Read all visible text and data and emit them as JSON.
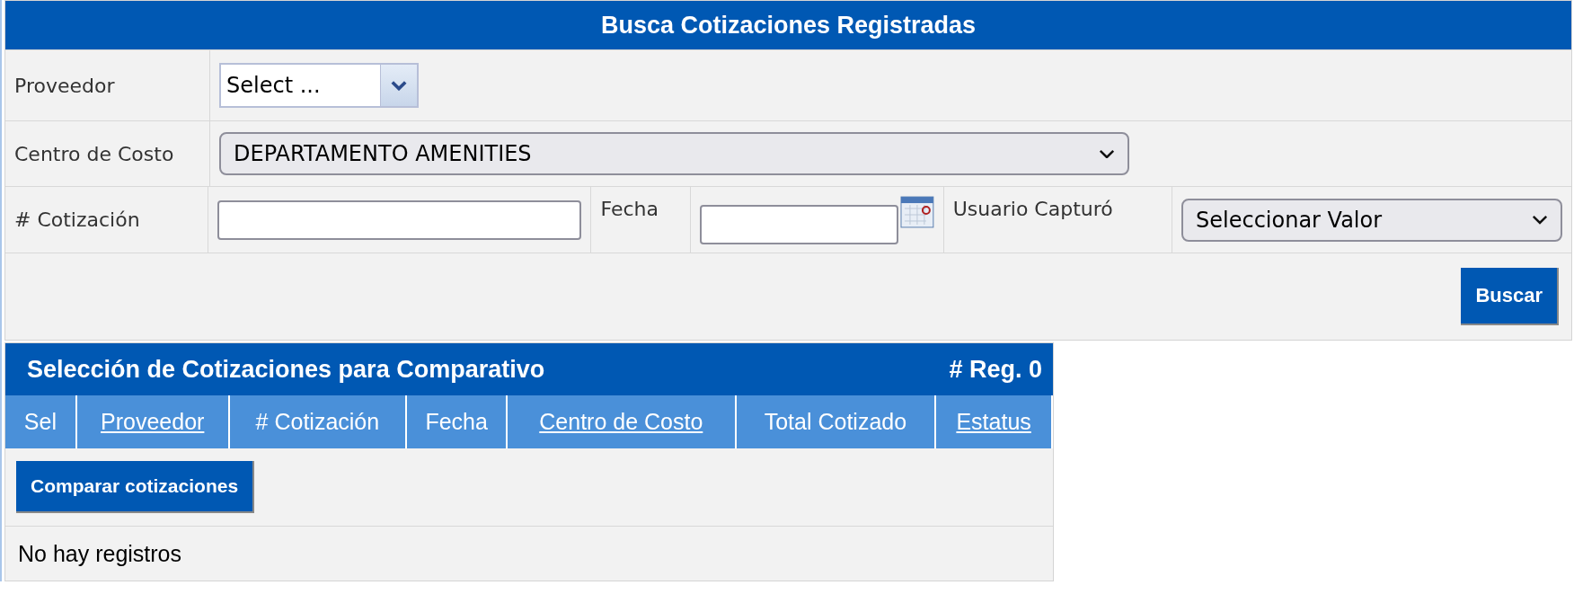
{
  "search_panel": {
    "title": "Busca Cotizaciones Registradas",
    "proveedor": {
      "label": "Proveedor",
      "value": "Select ..."
    },
    "centro_de_costo": {
      "label": "Centro de Costo",
      "value": "DEPARTAMENTO AMENITIES"
    },
    "cotizacion": {
      "label": "# Cotización"
    },
    "fecha": {
      "label": "Fecha"
    },
    "usuario": {
      "label": "Usuario Capturó",
      "value": "Seleccionar Valor"
    },
    "search_button": "Buscar"
  },
  "results": {
    "title": "Selección de Cotizaciones para Comparativo",
    "count": "# Reg. 0",
    "columns": [
      {
        "label": "Sel",
        "link": false
      },
      {
        "label": "Proveedor",
        "link": true
      },
      {
        "label": "# Cotización",
        "link": false
      },
      {
        "label": "Fecha",
        "link": false
      },
      {
        "label": "Centro de Costo",
        "link": true
      },
      {
        "label": "Total Cotizado",
        "link": false
      },
      {
        "label": "Estatus",
        "link": true
      }
    ],
    "compare_button": "Comparar cotizaciones",
    "empty_message": "No hay registros"
  }
}
